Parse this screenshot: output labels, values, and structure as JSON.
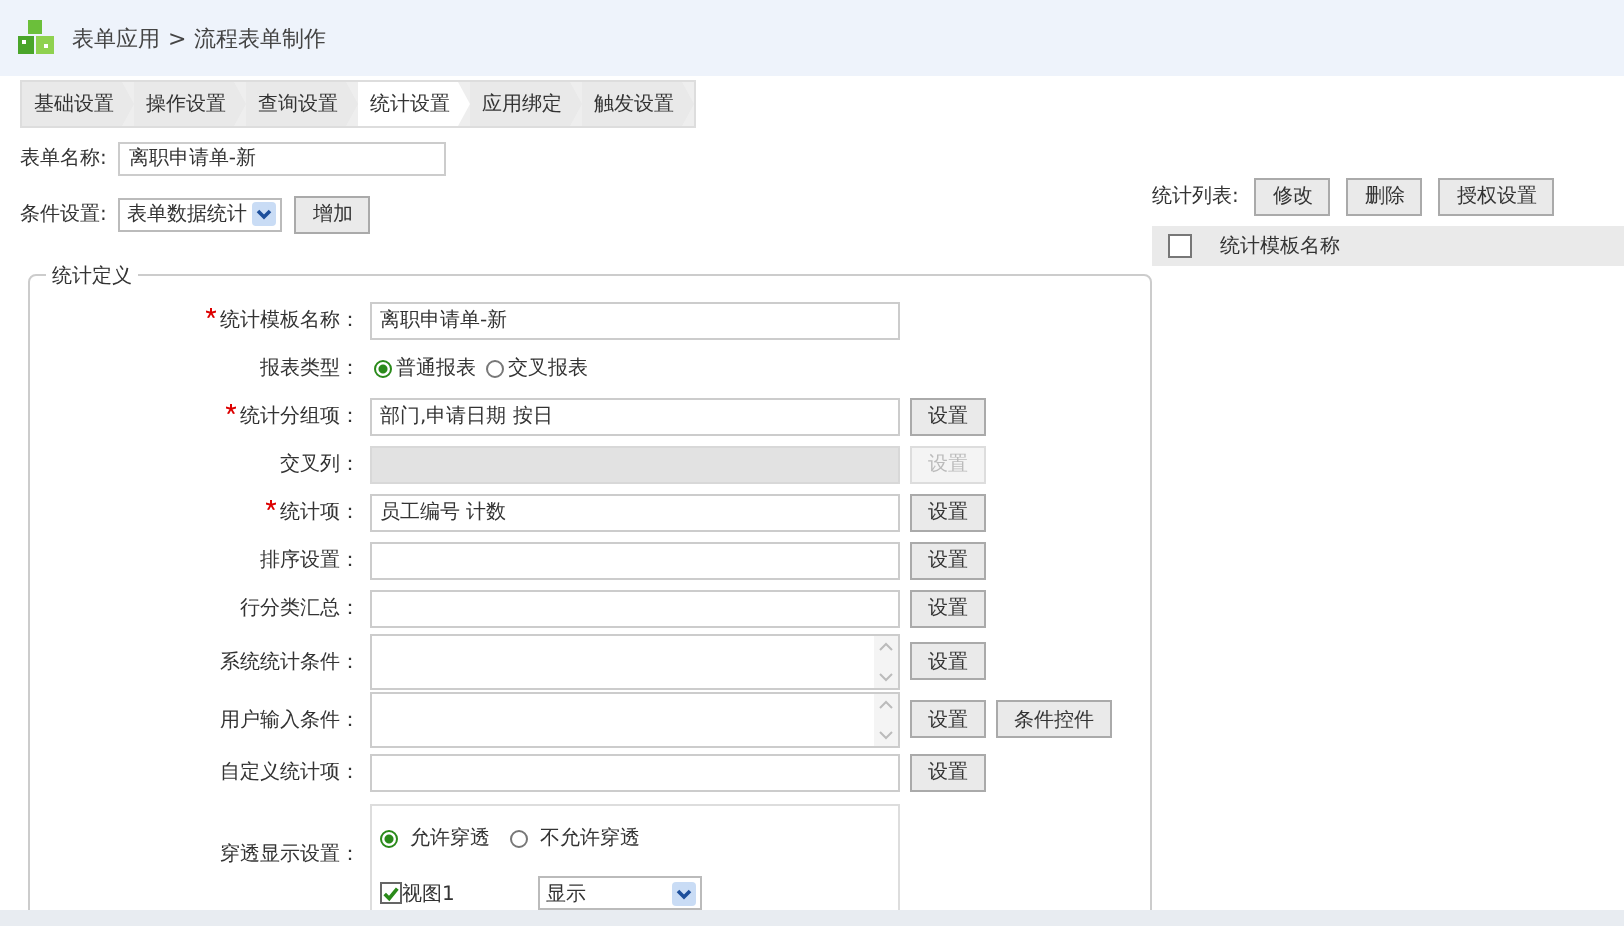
{
  "breadcrumb": {
    "parent": "表单应用",
    "separator": ">",
    "current": "流程表单制作"
  },
  "tabs": [
    {
      "label": "基础设置",
      "selected": false
    },
    {
      "label": "操作设置",
      "selected": false
    },
    {
      "label": "查询设置",
      "selected": false
    },
    {
      "label": "统计设置",
      "selected": true
    },
    {
      "label": "应用绑定",
      "selected": false
    },
    {
      "label": "触发设置",
      "selected": false
    }
  ],
  "form_name": {
    "label": "表单名称:",
    "value": "离职申请单-新"
  },
  "condition": {
    "label": "条件设置:",
    "value": "表单数据统计",
    "button": "增加"
  },
  "definition": {
    "legend": "统计定义",
    "rows": [
      {
        "kind": "input",
        "label": "统计模板名称：",
        "required": true,
        "value": "离职申请单-新",
        "disabled": false,
        "buttons": []
      },
      {
        "kind": "radio",
        "label": "报表类型：",
        "required": false,
        "options": [
          {
            "label": "普通报表",
            "selected": true
          },
          {
            "label": "交叉报表",
            "selected": false
          }
        ],
        "buttons": []
      },
      {
        "kind": "input",
        "label": "统计分组项：",
        "required": true,
        "value": "部门,申请日期 按日",
        "disabled": false,
        "buttons": [
          {
            "label": "设置",
            "disabled": false
          }
        ]
      },
      {
        "kind": "input",
        "label": "交叉列：",
        "required": false,
        "value": "",
        "disabled": true,
        "buttons": [
          {
            "label": "设置",
            "disabled": true
          }
        ]
      },
      {
        "kind": "input",
        "label": "统计项：",
        "required": true,
        "value": "员工编号 计数",
        "disabled": false,
        "buttons": [
          {
            "label": "设置",
            "disabled": false
          }
        ]
      },
      {
        "kind": "input",
        "label": "排序设置：",
        "required": false,
        "value": "",
        "disabled": false,
        "buttons": [
          {
            "label": "设置",
            "disabled": false
          }
        ]
      },
      {
        "kind": "input",
        "label": "行分类汇总：",
        "required": false,
        "value": "",
        "disabled": false,
        "buttons": [
          {
            "label": "设置",
            "disabled": false
          }
        ]
      },
      {
        "kind": "textarea",
        "label": "系统统计条件：",
        "required": false,
        "value": "",
        "disabled": false,
        "buttons": [
          {
            "label": "设置",
            "disabled": false
          }
        ]
      },
      {
        "kind": "textarea",
        "label": "用户输入条件：",
        "required": false,
        "value": "",
        "disabled": false,
        "buttons": [
          {
            "label": "设置",
            "disabled": false
          },
          {
            "label": "条件控件",
            "disabled": false
          }
        ]
      },
      {
        "kind": "input",
        "label": "自定义统计项：",
        "required": false,
        "value": "",
        "disabled": false,
        "buttons": [
          {
            "label": "设置",
            "disabled": false
          }
        ]
      },
      {
        "kind": "drill",
        "label": "穿透显示设置：",
        "required": false,
        "options": [
          {
            "label": "允许穿透",
            "selected": true
          },
          {
            "label": "不允许穿透",
            "selected": false
          }
        ],
        "views": [
          {
            "label": "视图1",
            "checked": true,
            "display": "显示"
          }
        ],
        "buttons": []
      }
    ]
  },
  "stat_list": {
    "label": "统计列表:",
    "buttons": [
      "修改",
      "删除",
      "授权设置"
    ],
    "columns": [
      "统计模板名称"
    ],
    "select_all_checked": false
  }
}
